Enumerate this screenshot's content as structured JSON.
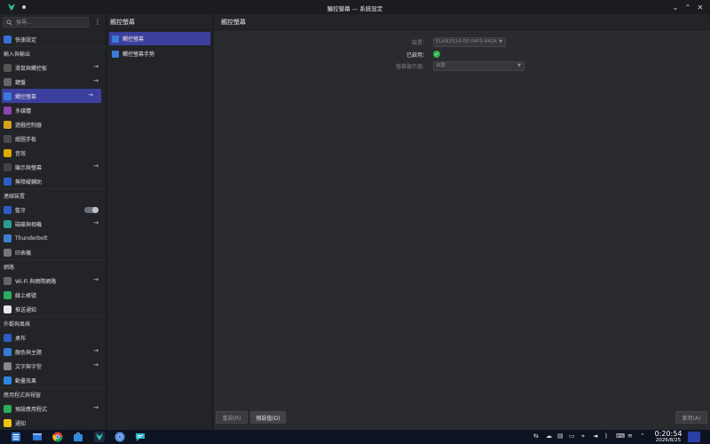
{
  "window": {
    "title": "觸控螢幕 — 系統設定",
    "minimize": "⌄",
    "maximize": "⌃",
    "close": "✕"
  },
  "search": {
    "placeholder": "搜尋..."
  },
  "sidebar": {
    "items": [
      {
        "type": "item",
        "label": "快速設定",
        "icon": "quick-settings-icon",
        "color": "#3a6fd8"
      },
      {
        "type": "header",
        "label": "輸入與輸出"
      },
      {
        "type": "item",
        "label": "滑鼠與觸控板",
        "icon": "mouse-icon",
        "color": "#555",
        "chevron": true
      },
      {
        "type": "item",
        "label": "鍵盤",
        "icon": "keyboard-icon",
        "color": "#666",
        "chevron": true
      },
      {
        "type": "item",
        "label": "觸控螢幕",
        "icon": "touchscreen-icon",
        "color": "#3a7bd5",
        "active": true,
        "chevron": true
      },
      {
        "type": "item",
        "label": "多媒體",
        "icon": "multimedia-icon",
        "color": "#8e44ad"
      },
      {
        "type": "item",
        "label": "遊戲控制器",
        "icon": "game-controller-icon",
        "color": "#d6a21e"
      },
      {
        "type": "item",
        "label": "繪圖手板",
        "icon": "drawing-tablet-icon",
        "color": "#4b4b4b"
      },
      {
        "type": "item",
        "label": "音效",
        "icon": "sound-icon",
        "color": "#e0a800"
      },
      {
        "type": "item",
        "label": "顯示與螢幕",
        "icon": "display-icon",
        "color": "#444",
        "chevron": true
      },
      {
        "type": "item",
        "label": "無障礙輔助",
        "icon": "accessibility-icon",
        "color": "#2b5fc7"
      },
      {
        "type": "header",
        "label": "連線裝置"
      },
      {
        "type": "item",
        "label": "藍牙",
        "icon": "bluetooth-icon",
        "color": "#2b5fc7",
        "toggle": true
      },
      {
        "type": "item",
        "label": "磁碟與相機",
        "icon": "disks-cameras-icon",
        "color": "#2a9d8f",
        "chevron": true
      },
      {
        "type": "item",
        "label": "Thunderbolt",
        "icon": "thunderbolt-icon",
        "color": "#3f7fd1"
      },
      {
        "type": "item",
        "label": "印表機",
        "icon": "printer-icon",
        "color": "#777"
      },
      {
        "type": "header",
        "label": "網路"
      },
      {
        "type": "item",
        "label": "Wi-Fi 與網際網路",
        "icon": "wifi-icon",
        "color": "#666",
        "chevron": true
      },
      {
        "type": "item",
        "label": "線上帳號",
        "icon": "online-accounts-icon",
        "color": "#27ae60"
      },
      {
        "type": "item",
        "label": "推送通知",
        "icon": "push-notifications-icon",
        "color": "#e8e8e8"
      },
      {
        "type": "header",
        "label": "外觀與風格"
      },
      {
        "type": "item",
        "label": "桌布",
        "icon": "wallpaper-icon",
        "color": "#2b5fc7"
      },
      {
        "type": "item",
        "label": "顏色與主題",
        "icon": "colors-themes-icon",
        "color": "#3a7bd5",
        "chevron": true
      },
      {
        "type": "item",
        "label": "文字與字型",
        "icon": "text-fonts-icon",
        "color": "#888",
        "chevron": true
      },
      {
        "type": "item",
        "label": "動畫效果",
        "icon": "animations-icon",
        "color": "#2e86de"
      },
      {
        "type": "header",
        "label": "應用程式與視窗"
      },
      {
        "type": "item",
        "label": "預設應用程式",
        "icon": "default-apps-icon",
        "color": "#27ae60",
        "chevron": true
      },
      {
        "type": "item",
        "label": "通知",
        "icon": "notifications-icon",
        "color": "#f1c40f"
      }
    ]
  },
  "middle": {
    "title": "觸控螢幕",
    "items": [
      {
        "label": "觸控螢幕",
        "active": true
      },
      {
        "label": "觸控螢幕手勢",
        "active": false
      }
    ]
  },
  "main": {
    "title": "觸控螢幕",
    "device_label": "裝置：",
    "device_value": "ELAN2514:00 04F3:442A",
    "enabled_label": "已啟用：",
    "orientation_label": "螢幕顯示器：",
    "orientation_value": "自動"
  },
  "footer": {
    "reset_label": "重設(R)",
    "defaults_label": "預設值(D)",
    "apply_label": "套用(A)"
  },
  "taskbar": {
    "time": "0:20:54",
    "date": "2026/8/25"
  }
}
